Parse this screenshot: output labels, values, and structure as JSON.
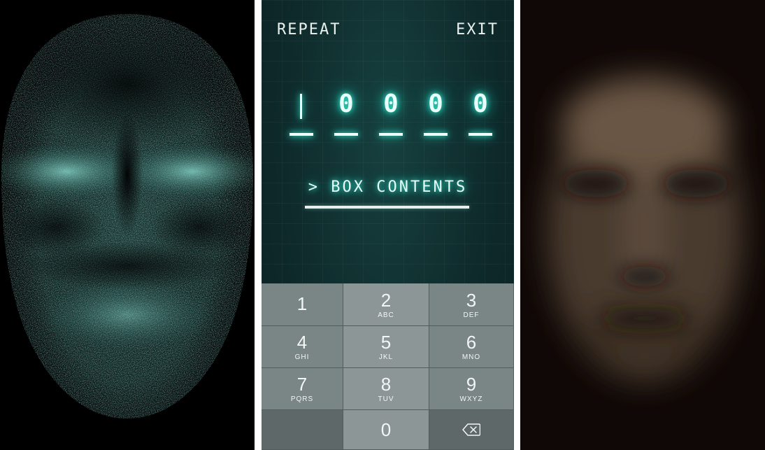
{
  "colors": {
    "teal_glow": "#38f0d6",
    "phone_bg": "#0f2b2c",
    "keypad_key": "#7a8586",
    "face_particles": "#5fb8ad",
    "blur_face": "#6b5745"
  },
  "phone": {
    "repeat_label": "REPEAT",
    "exit_label": "EXIT",
    "code_slots": [
      {
        "digit": "",
        "has_cursor": true
      },
      {
        "digit": "0"
      },
      {
        "digit": "0"
      },
      {
        "digit": "0"
      },
      {
        "digit": "0"
      }
    ],
    "box_contents_label": "> BOX CONTENTS",
    "keypad": [
      {
        "num": "1",
        "letters": ""
      },
      {
        "num": "2",
        "letters": "ABC"
      },
      {
        "num": "3",
        "letters": "DEF"
      },
      {
        "num": "4",
        "letters": "GHI"
      },
      {
        "num": "5",
        "letters": "JKL"
      },
      {
        "num": "6",
        "letters": "MNO"
      },
      {
        "num": "7",
        "letters": "PQRS"
      },
      {
        "num": "8",
        "letters": "TUV"
      },
      {
        "num": "9",
        "letters": "WXYZ"
      },
      {
        "num": "",
        "letters": ""
      },
      {
        "num": "0",
        "letters": ""
      },
      {
        "icon": "backspace-icon"
      }
    ]
  },
  "icons": {
    "delete": "backspace-icon"
  }
}
